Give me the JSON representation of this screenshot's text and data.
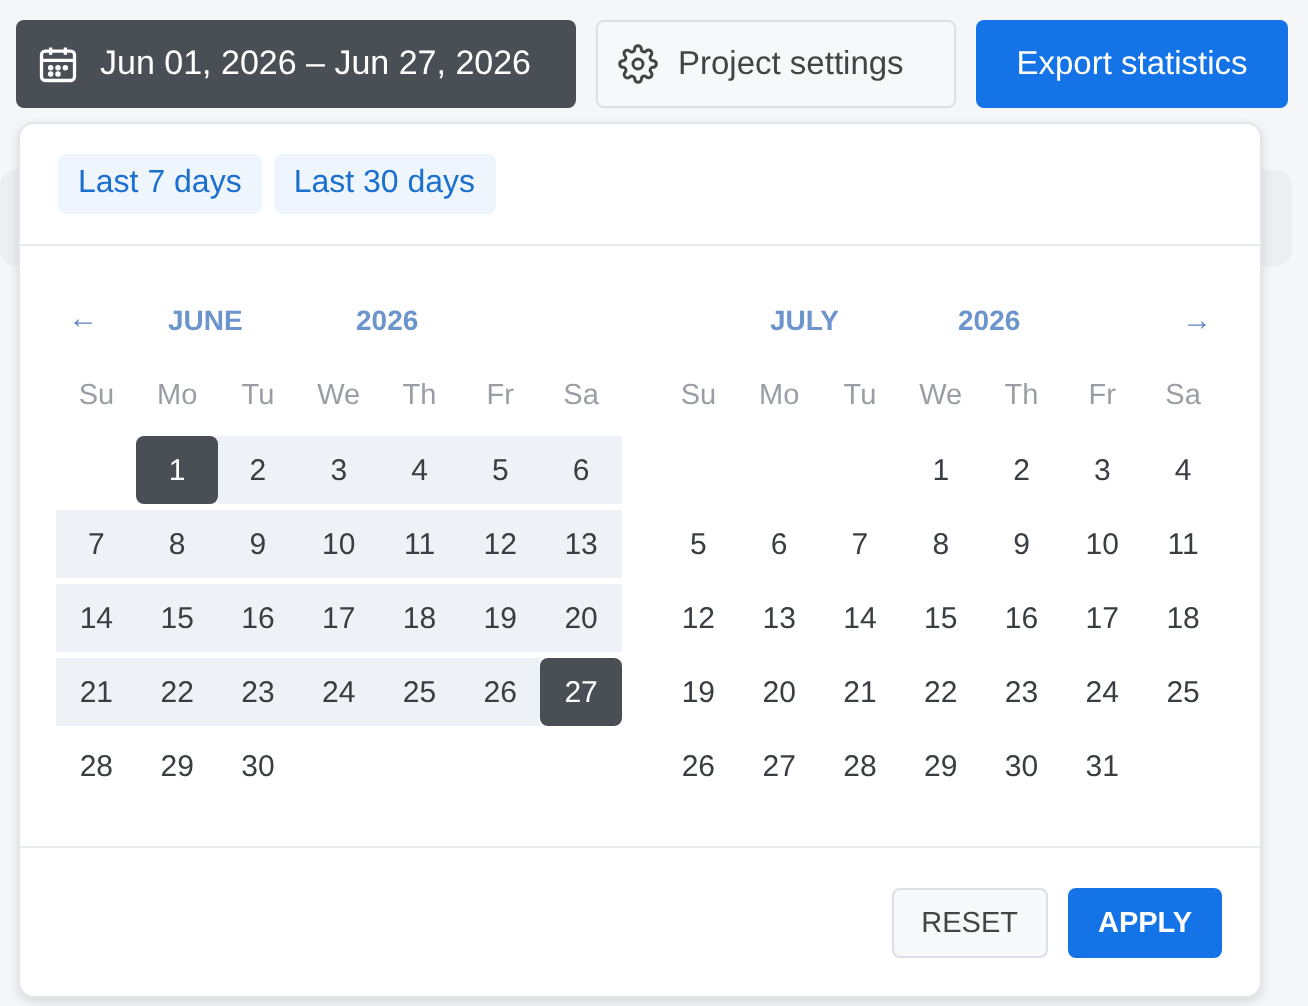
{
  "toolbar": {
    "date_range": "Jun 01, 2026 – Jun 27, 2026",
    "settings_button": "Project settings",
    "export_button": "Export statistics"
  },
  "presets": [
    {
      "label": "Last 7 days",
      "selected": false
    },
    {
      "label": "Last 30 days",
      "selected": false
    }
  ],
  "prev_arrow": "←",
  "next_arrow": "→",
  "months": [
    {
      "month": "JUNE",
      "year": "2026",
      "weekdays": [
        "Su",
        "Mo",
        "Tu",
        "We",
        "Th",
        "Fr",
        "Sa"
      ],
      "weeks": [
        {
          "starts_midweek": true,
          "days": [
            {
              "day": "1",
              "selected": true,
              "in_range": false
            },
            {
              "day": "2",
              "selected": false,
              "in_range": true
            },
            {
              "day": "3",
              "selected": false,
              "in_range": true
            },
            {
              "day": "4",
              "selected": false,
              "in_range": true
            },
            {
              "day": "5",
              "selected": false,
              "in_range": true
            },
            {
              "day": "6",
              "selected": false,
              "in_range": true
            }
          ]
        },
        {
          "starts_midweek": false,
          "days": [
            {
              "day": "7",
              "selected": false,
              "in_range": true
            },
            {
              "day": "8",
              "selected": false,
              "in_range": true
            },
            {
              "day": "9",
              "selected": false,
              "in_range": true
            },
            {
              "day": "10",
              "selected": false,
              "in_range": true
            },
            {
              "day": "11",
              "selected": false,
              "in_range": true
            },
            {
              "day": "12",
              "selected": false,
              "in_range": true
            },
            {
              "day": "13",
              "selected": false,
              "in_range": true
            }
          ]
        },
        {
          "starts_midweek": false,
          "days": [
            {
              "day": "14",
              "selected": false,
              "in_range": true
            },
            {
              "day": "15",
              "selected": false,
              "in_range": true
            },
            {
              "day": "16",
              "selected": false,
              "in_range": true
            },
            {
              "day": "17",
              "selected": false,
              "in_range": true
            },
            {
              "day": "18",
              "selected": false,
              "in_range": true
            },
            {
              "day": "19",
              "selected": false,
              "in_range": true
            },
            {
              "day": "20",
              "selected": false,
              "in_range": true
            }
          ]
        },
        {
          "starts_midweek": false,
          "days": [
            {
              "day": "21",
              "selected": false,
              "in_range": true
            },
            {
              "day": "22",
              "selected": false,
              "in_range": true
            },
            {
              "day": "23",
              "selected": false,
              "in_range": true
            },
            {
              "day": "24",
              "selected": false,
              "in_range": true
            },
            {
              "day": "25",
              "selected": false,
              "in_range": true
            },
            {
              "day": "26",
              "selected": false,
              "in_range": true
            },
            {
              "day": "27",
              "selected": true,
              "in_range": false
            }
          ]
        },
        {
          "starts_midweek": false,
          "days": [
            {
              "day": "28",
              "selected": false,
              "in_range": false
            },
            {
              "day": "29",
              "selected": false,
              "in_range": false
            },
            {
              "day": "30",
              "selected": false,
              "in_range": false
            }
          ]
        }
      ]
    },
    {
      "month": "JULY",
      "year": "2026",
      "weekdays": [
        "Su",
        "Mo",
        "Tu",
        "We",
        "Th",
        "Fr",
        "Sa"
      ],
      "weeks": [
        {
          "starts_midweek": true,
          "days": [
            {
              "day": "1",
              "selected": false,
              "in_range": false
            },
            {
              "day": "2",
              "selected": false,
              "in_range": false
            },
            {
              "day": "3",
              "selected": false,
              "in_range": false
            },
            {
              "day": "4",
              "selected": false,
              "in_range": false
            }
          ]
        },
        {
          "starts_midweek": false,
          "days": [
            {
              "day": "5",
              "selected": false,
              "in_range": false
            },
            {
              "day": "6",
              "selected": false,
              "in_range": false
            },
            {
              "day": "7",
              "selected": false,
              "in_range": false
            },
            {
              "day": "8",
              "selected": false,
              "in_range": false
            },
            {
              "day": "9",
              "selected": false,
              "in_range": false
            },
            {
              "day": "10",
              "selected": false,
              "in_range": false
            },
            {
              "day": "11",
              "selected": false,
              "in_range": false
            }
          ]
        },
        {
          "starts_midweek": false,
          "days": [
            {
              "day": "12",
              "selected": false,
              "in_range": false
            },
            {
              "day": "13",
              "selected": false,
              "in_range": false
            },
            {
              "day": "14",
              "selected": false,
              "in_range": false
            },
            {
              "day": "15",
              "selected": false,
              "in_range": false
            },
            {
              "day": "16",
              "selected": false,
              "in_range": false
            },
            {
              "day": "17",
              "selected": false,
              "in_range": false
            },
            {
              "day": "18",
              "selected": false,
              "in_range": false
            }
          ]
        },
        {
          "starts_midweek": false,
          "days": [
            {
              "day": "19",
              "selected": false,
              "in_range": false
            },
            {
              "day": "20",
              "selected": false,
              "in_range": false
            },
            {
              "day": "21",
              "selected": false,
              "in_range": false
            },
            {
              "day": "22",
              "selected": false,
              "in_range": false
            },
            {
              "day": "23",
              "selected": false,
              "in_range": false
            },
            {
              "day": "24",
              "selected": false,
              "in_range": false
            },
            {
              "day": "25",
              "selected": false,
              "in_range": false
            }
          ]
        },
        {
          "starts_midweek": false,
          "days": [
            {
              "day": "26",
              "selected": false,
              "in_range": false
            },
            {
              "day": "27",
              "selected": false,
              "in_range": false
            },
            {
              "day": "28",
              "selected": false,
              "in_range": false
            },
            {
              "day": "29",
              "selected": false,
              "in_range": false
            },
            {
              "day": "30",
              "selected": false,
              "in_range": false
            },
            {
              "day": "31",
              "selected": false,
              "in_range": false
            }
          ]
        }
      ]
    }
  ],
  "footer": {
    "reset_button": "RESET",
    "apply_button": "APPLY"
  }
}
